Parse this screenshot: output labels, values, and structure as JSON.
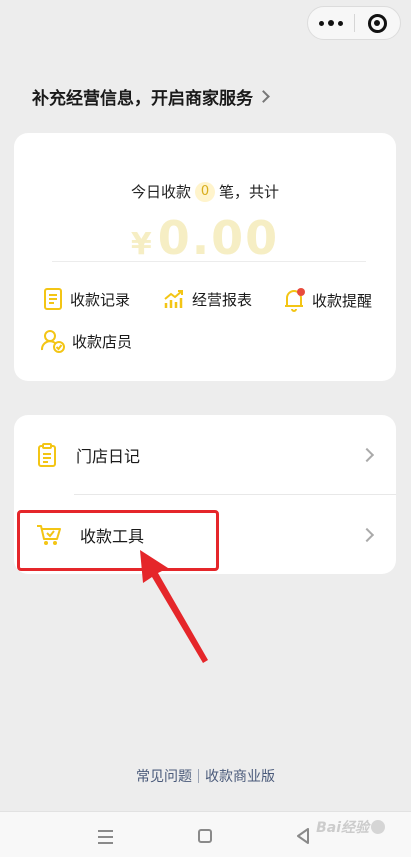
{
  "merchant_link": {
    "label": "补充经营信息，开启商家服务"
  },
  "income_card": {
    "today_prefix": "今日收款",
    "today_count": "0",
    "today_suffix": "笔，共计",
    "currency": "¥",
    "amount": "0.00"
  },
  "shortcuts": [
    {
      "label": "收款记录",
      "icon": "receipt-icon"
    },
    {
      "label": "经营报表",
      "icon": "chart-icon"
    },
    {
      "label": "收款提醒",
      "icon": "bell-icon"
    },
    {
      "label": "收款店员",
      "icon": "staff-icon"
    }
  ],
  "menu": [
    {
      "label": "门店日记",
      "icon": "clipboard-icon"
    },
    {
      "label": "收款工具",
      "icon": "cart-icon"
    }
  ],
  "footer": {
    "faq": "常见问题",
    "business": "收款商业版"
  },
  "watermark": {
    "text": "Bai经验"
  },
  "colors": {
    "accent": "#f3c515",
    "annotation": "#e5262a",
    "badge_red": "#e84b3c",
    "footer_link": "#4a5a7a"
  }
}
